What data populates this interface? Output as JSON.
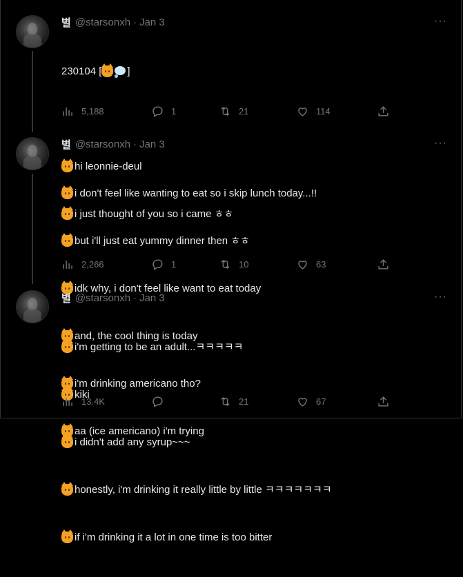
{
  "tweets": [
    {
      "display_name": "별",
      "handle": "@starsonxh",
      "separator": "·",
      "date": "Jan 3",
      "more": "···",
      "lines": [
        {
          "emoji": [],
          "text": "230104 [",
          "suffix_emoji": [
            "cat",
            "bubble"
          ],
          "suffix": "]"
        },
        {
          "emoji": [],
          "text": ""
        },
        {
          "emoji": [
            "cat"
          ],
          "text": "hi leonnie-deul"
        },
        {
          "emoji": [
            "cat"
          ],
          "text": "i just thought of you so i came ㅎㅎ"
        }
      ],
      "views": "5,188",
      "replies": "1",
      "retweets": "21",
      "likes": "114"
    },
    {
      "display_name": "별",
      "handle": "@starsonxh",
      "separator": "·",
      "date": "Jan 3",
      "more": "···",
      "lines": [
        {
          "emoji": [
            "cat"
          ],
          "text": "i don't feel like wanting to eat so i skip lunch today...!!"
        },
        {
          "emoji": [
            "cat"
          ],
          "text": "but i'll just eat yummy dinner then ㅎㅎ"
        },
        {
          "emoji": [
            "cat"
          ],
          "text": "idk why, i don't feel like want to eat today"
        },
        {
          "emoji": [
            "cat"
          ],
          "text": "and, the cool thing is today"
        },
        {
          "emoji": [
            "cat"
          ],
          "text": "i'm drinking americano tho?"
        },
        {
          "emoji": [
            "cat"
          ],
          "text": "aa (ice americano) i'm trying"
        }
      ],
      "views": "2,266",
      "replies": "1",
      "retweets": "10",
      "likes": "63"
    },
    {
      "display_name": "별",
      "handle": "@starsonxh",
      "separator": "·",
      "date": "Jan 3",
      "more": "···",
      "lines": [
        {
          "emoji": [
            "cat"
          ],
          "text": "i'm getting to be an adult...ㅋㅋㅋㅋㅋ"
        },
        {
          "emoji": [
            "cat"
          ],
          "text": "kiki"
        },
        {
          "emoji": [
            "cat"
          ],
          "text": "i didn't add any syrup~~~"
        },
        {
          "emoji": [
            "cat"
          ],
          "text": "honestly, i'm drinking it really little by little ㅋㅋㅋㅋㅋㅋㅋ"
        },
        {
          "emoji": [
            "cat"
          ],
          "text": "if i'm drinking it a lot in one time is too bitter"
        }
      ],
      "views": "13.4K",
      "replies": "",
      "retweets": "21",
      "likes": "67"
    }
  ],
  "icons": {
    "views": "bar-chart-icon",
    "reply": "speech-bubble-icon",
    "retweet": "retweet-icon",
    "like": "heart-icon",
    "share": "share-upload-icon",
    "cat_emoji": "cat-face-emoji",
    "bubble_emoji": "thought-balloon-emoji"
  },
  "colors": {
    "background": "#000000",
    "text": "#e7e9ea",
    "muted": "#71767b",
    "border": "#2f3336"
  }
}
